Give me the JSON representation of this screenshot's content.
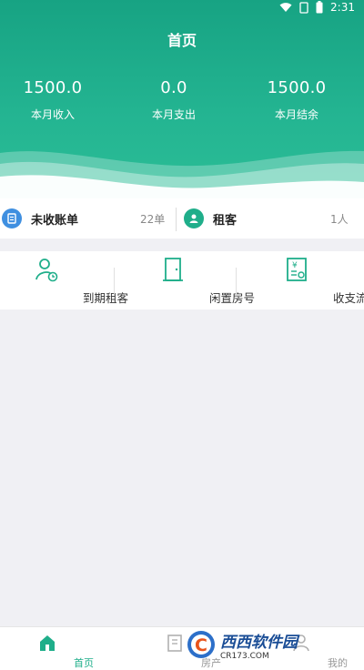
{
  "status": {
    "time": "2:31"
  },
  "header": {
    "title": "首页"
  },
  "stats": [
    {
      "value": "1500.0",
      "label": "本月收入"
    },
    {
      "value": "0.0",
      "label": "本月支出"
    },
    {
      "value": "1500.0",
      "label": "本月结余"
    }
  ],
  "summary": {
    "unpaid": {
      "label": "未收账单",
      "count": "22单",
      "icon": "bill-icon"
    },
    "tenants": {
      "label": "租客",
      "count": "1人",
      "icon": "person-icon"
    }
  },
  "actions": [
    {
      "label": "到期租客",
      "icon": "person-clock-icon"
    },
    {
      "label": "闲置房号",
      "icon": "door-icon"
    },
    {
      "label": "收支流水",
      "icon": "ledger-icon"
    }
  ],
  "nav": [
    {
      "label": "首页",
      "icon": "home-icon"
    },
    {
      "label": "房产",
      "icon": "building-icon"
    },
    {
      "label": "我的",
      "icon": "profile-icon"
    }
  ],
  "watermark": {
    "brand": "西西软件园",
    "url": "CR173.COM",
    "logo_letter": "C"
  },
  "colors": {
    "primary": "#1fae8a",
    "accent_blue": "#3f8fe0",
    "text": "#333333"
  }
}
